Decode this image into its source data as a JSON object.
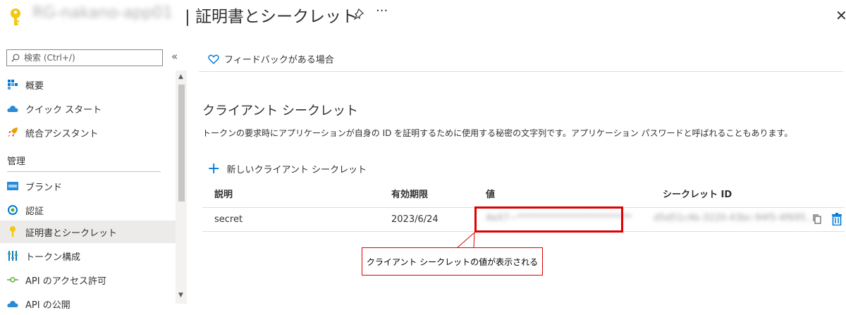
{
  "header": {
    "app_name": "RG-nakano-app01",
    "title": "| 証明書とシークレット",
    "more_label": "···",
    "close_label": "✕"
  },
  "sidebar": {
    "search_placeholder": "検索 (Ctrl+/)",
    "collapse_label": "«",
    "items_top": [
      {
        "label": "概要",
        "icon": "grid-icon"
      },
      {
        "label": "クイック スタート",
        "icon": "cloud-icon"
      },
      {
        "label": "統合アシスタント",
        "icon": "rocket-icon"
      }
    ],
    "section": "管理",
    "items_manage": [
      {
        "label": "ブランド",
        "icon": "branding-icon"
      },
      {
        "label": "認証",
        "icon": "auth-icon"
      },
      {
        "label": "証明書とシークレット",
        "icon": "key-icon",
        "active": true
      },
      {
        "label": "トークン構成",
        "icon": "token-icon"
      },
      {
        "label": "API のアクセス許可",
        "icon": "api-icon"
      },
      {
        "label": "API の公開",
        "icon": "cloud-icon"
      }
    ],
    "scroll_up": "▲",
    "scroll_down": "▼"
  },
  "toolbar": {
    "feedback_label": "フィードバックがある場合"
  },
  "main": {
    "section_title": "クライアント シークレット",
    "description": "トークンの要求時にアプリケーションが自身の ID を証明するために使用する秘密の文字列です。アプリケーション パスワードと呼ばれることもあります。",
    "new_secret_label": "新しいクライアント シークレット",
    "new_secret_plus": "+",
    "table": {
      "headers": [
        "説明",
        "有効期限",
        "値",
        "シークレット ID"
      ],
      "rows": [
        {
          "description": "secret",
          "expires": "2023/6/24",
          "value": "4eX7~*************************",
          "secret_id": "d5d51c4b-3220-43bc-94f5-4f695..."
        }
      ]
    },
    "callout": "クライアント シークレットの値が表示される"
  },
  "colors": {
    "accent": "#0078d4",
    "key": "#f2c811",
    "highlight": "#e00000"
  }
}
